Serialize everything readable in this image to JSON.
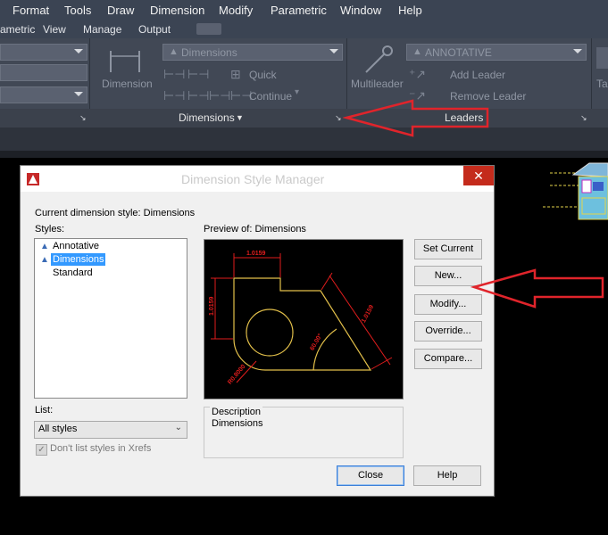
{
  "menu": [
    "Format",
    "Tools",
    "Draw",
    "Dimension",
    "Modify",
    "Parametric",
    "Window",
    "Help"
  ],
  "ribbon_tabs": [
    "ametric",
    "View",
    "Manage",
    "Output"
  ],
  "ribbon": {
    "dimension_label": "Dimension",
    "dim_style_value": "Dimensions",
    "quick": "Quick",
    "continue": "Continue",
    "dimensions_panel": "Dimensions",
    "multileader": "Multileader",
    "leader_style_value": "ANNOTATIVE",
    "add_leader": "Add Leader",
    "remove_leader": "Remove Leader",
    "leaders_panel": "Leaders",
    "right_cut": "Ta"
  },
  "dialog": {
    "title": "Dimension Style Manager",
    "current_style_label": "Current dimension style: Dimensions",
    "styles_label": "Styles:",
    "styles": [
      "Annotative",
      "Dimensions",
      "Standard"
    ],
    "selected_style": "Dimensions",
    "preview_label": "Preview of: Dimensions",
    "list_label": "List:",
    "list_value": "All styles",
    "dont_list_xrefs": "Don't list styles in Xrefs",
    "description_label": "Description",
    "description_value": "Dimensions",
    "buttons": {
      "set_current": "Set Current",
      "new": "New...",
      "modify": "Modify...",
      "override": "Override...",
      "compare": "Compare...",
      "close": "Close",
      "help": "Help"
    },
    "preview_dims": [
      "1.0159",
      "1.0159",
      "1.0159",
      "60.00°",
      "R0.8000"
    ]
  },
  "colors": {
    "annotation_arrow": "#e0242b",
    "menu_bg": "#3b4453",
    "ribbon_bg": "#414855",
    "selection": "#3399ff",
    "preview_geometry": "#e3c04a",
    "preview_dims": "#e11d1d"
  }
}
